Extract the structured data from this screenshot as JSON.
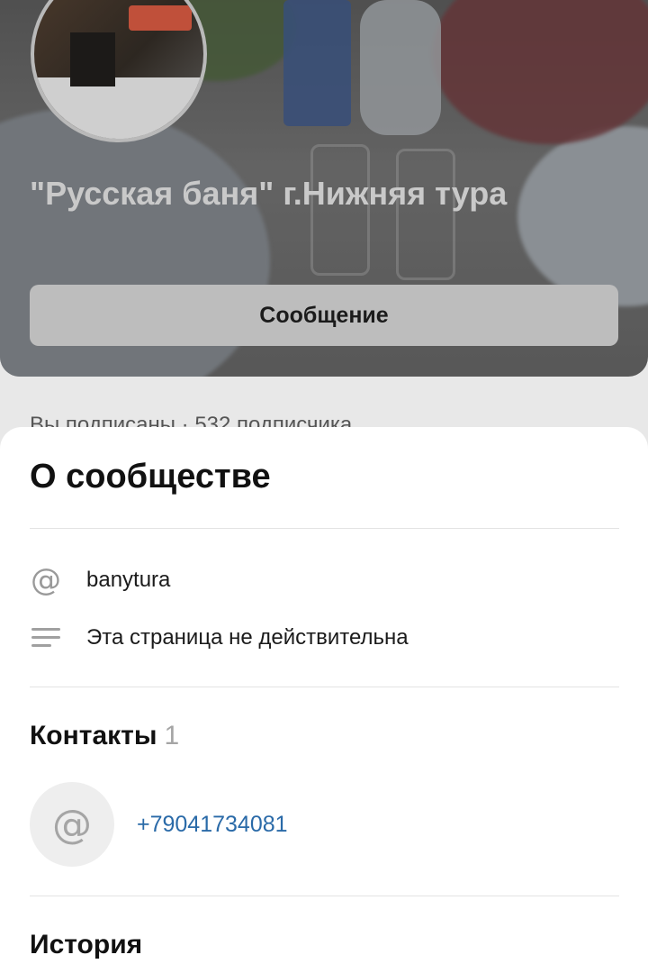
{
  "header": {
    "group_title": "\"Русская баня\" г.Нижняя тура",
    "message_button": "Сообщение",
    "subscribers_peek": "Вы подписаны · 532 подписчика"
  },
  "about_sheet": {
    "title": "О сообществе",
    "items": [
      {
        "icon": "at-icon",
        "text": "banytura"
      },
      {
        "icon": "text-lines-icon",
        "text": "Эта страница не действительна"
      }
    ]
  },
  "contacts": {
    "title": "Контакты",
    "count": "1",
    "items": [
      {
        "icon": "at-icon",
        "value": "+79041734081"
      }
    ]
  },
  "history": {
    "title": "История"
  },
  "colors": {
    "link": "#2a6aa8",
    "sheet_bg": "#ffffff"
  }
}
